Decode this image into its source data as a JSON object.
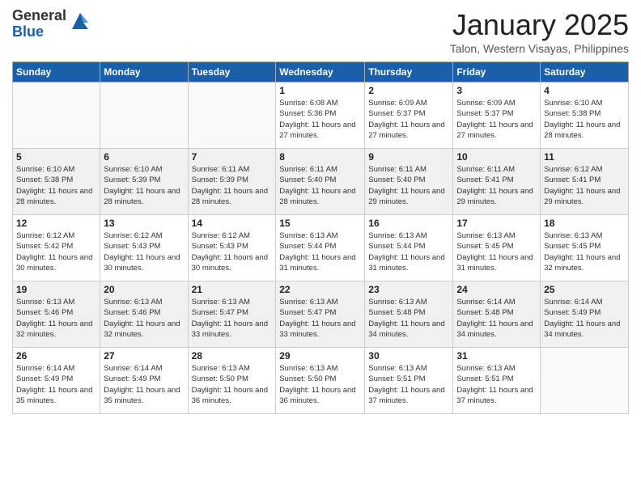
{
  "header": {
    "logo_general": "General",
    "logo_blue": "Blue",
    "month_title": "January 2025",
    "location": "Talon, Western Visayas, Philippines"
  },
  "weekdays": [
    "Sunday",
    "Monday",
    "Tuesday",
    "Wednesday",
    "Thursday",
    "Friday",
    "Saturday"
  ],
  "weeks": [
    [
      {
        "day": "",
        "sunrise": "",
        "sunset": "",
        "daylight": ""
      },
      {
        "day": "",
        "sunrise": "",
        "sunset": "",
        "daylight": ""
      },
      {
        "day": "",
        "sunrise": "",
        "sunset": "",
        "daylight": ""
      },
      {
        "day": "1",
        "sunrise": "6:08 AM",
        "sunset": "5:36 PM",
        "daylight": "11 hours and 27 minutes."
      },
      {
        "day": "2",
        "sunrise": "6:09 AM",
        "sunset": "5:37 PM",
        "daylight": "11 hours and 27 minutes."
      },
      {
        "day": "3",
        "sunrise": "6:09 AM",
        "sunset": "5:37 PM",
        "daylight": "11 hours and 27 minutes."
      },
      {
        "day": "4",
        "sunrise": "6:10 AM",
        "sunset": "5:38 PM",
        "daylight": "11 hours and 28 minutes."
      }
    ],
    [
      {
        "day": "5",
        "sunrise": "6:10 AM",
        "sunset": "5:38 PM",
        "daylight": "11 hours and 28 minutes."
      },
      {
        "day": "6",
        "sunrise": "6:10 AM",
        "sunset": "5:39 PM",
        "daylight": "11 hours and 28 minutes."
      },
      {
        "day": "7",
        "sunrise": "6:11 AM",
        "sunset": "5:39 PM",
        "daylight": "11 hours and 28 minutes."
      },
      {
        "day": "8",
        "sunrise": "6:11 AM",
        "sunset": "5:40 PM",
        "daylight": "11 hours and 28 minutes."
      },
      {
        "day": "9",
        "sunrise": "6:11 AM",
        "sunset": "5:40 PM",
        "daylight": "11 hours and 29 minutes."
      },
      {
        "day": "10",
        "sunrise": "6:11 AM",
        "sunset": "5:41 PM",
        "daylight": "11 hours and 29 minutes."
      },
      {
        "day": "11",
        "sunrise": "6:12 AM",
        "sunset": "5:41 PM",
        "daylight": "11 hours and 29 minutes."
      }
    ],
    [
      {
        "day": "12",
        "sunrise": "6:12 AM",
        "sunset": "5:42 PM",
        "daylight": "11 hours and 30 minutes."
      },
      {
        "day": "13",
        "sunrise": "6:12 AM",
        "sunset": "5:43 PM",
        "daylight": "11 hours and 30 minutes."
      },
      {
        "day": "14",
        "sunrise": "6:12 AM",
        "sunset": "5:43 PM",
        "daylight": "11 hours and 30 minutes."
      },
      {
        "day": "15",
        "sunrise": "6:13 AM",
        "sunset": "5:44 PM",
        "daylight": "11 hours and 31 minutes."
      },
      {
        "day": "16",
        "sunrise": "6:13 AM",
        "sunset": "5:44 PM",
        "daylight": "11 hours and 31 minutes."
      },
      {
        "day": "17",
        "sunrise": "6:13 AM",
        "sunset": "5:45 PM",
        "daylight": "11 hours and 31 minutes."
      },
      {
        "day": "18",
        "sunrise": "6:13 AM",
        "sunset": "5:45 PM",
        "daylight": "11 hours and 32 minutes."
      }
    ],
    [
      {
        "day": "19",
        "sunrise": "6:13 AM",
        "sunset": "5:46 PM",
        "daylight": "11 hours and 32 minutes."
      },
      {
        "day": "20",
        "sunrise": "6:13 AM",
        "sunset": "5:46 PM",
        "daylight": "11 hours and 32 minutes."
      },
      {
        "day": "21",
        "sunrise": "6:13 AM",
        "sunset": "5:47 PM",
        "daylight": "11 hours and 33 minutes."
      },
      {
        "day": "22",
        "sunrise": "6:13 AM",
        "sunset": "5:47 PM",
        "daylight": "11 hours and 33 minutes."
      },
      {
        "day": "23",
        "sunrise": "6:13 AM",
        "sunset": "5:48 PM",
        "daylight": "11 hours and 34 minutes."
      },
      {
        "day": "24",
        "sunrise": "6:14 AM",
        "sunset": "5:48 PM",
        "daylight": "11 hours and 34 minutes."
      },
      {
        "day": "25",
        "sunrise": "6:14 AM",
        "sunset": "5:49 PM",
        "daylight": "11 hours and 34 minutes."
      }
    ],
    [
      {
        "day": "26",
        "sunrise": "6:14 AM",
        "sunset": "5:49 PM",
        "daylight": "11 hours and 35 minutes."
      },
      {
        "day": "27",
        "sunrise": "6:14 AM",
        "sunset": "5:49 PM",
        "daylight": "11 hours and 35 minutes."
      },
      {
        "day": "28",
        "sunrise": "6:13 AM",
        "sunset": "5:50 PM",
        "daylight": "11 hours and 36 minutes."
      },
      {
        "day": "29",
        "sunrise": "6:13 AM",
        "sunset": "5:50 PM",
        "daylight": "11 hours and 36 minutes."
      },
      {
        "day": "30",
        "sunrise": "6:13 AM",
        "sunset": "5:51 PM",
        "daylight": "11 hours and 37 minutes."
      },
      {
        "day": "31",
        "sunrise": "6:13 AM",
        "sunset": "5:51 PM",
        "daylight": "11 hours and 37 minutes."
      },
      {
        "day": "",
        "sunrise": "",
        "sunset": "",
        "daylight": ""
      }
    ]
  ],
  "labels": {
    "sunrise_prefix": "Sunrise: ",
    "sunset_prefix": "Sunset: ",
    "daylight_prefix": "Daylight: "
  }
}
